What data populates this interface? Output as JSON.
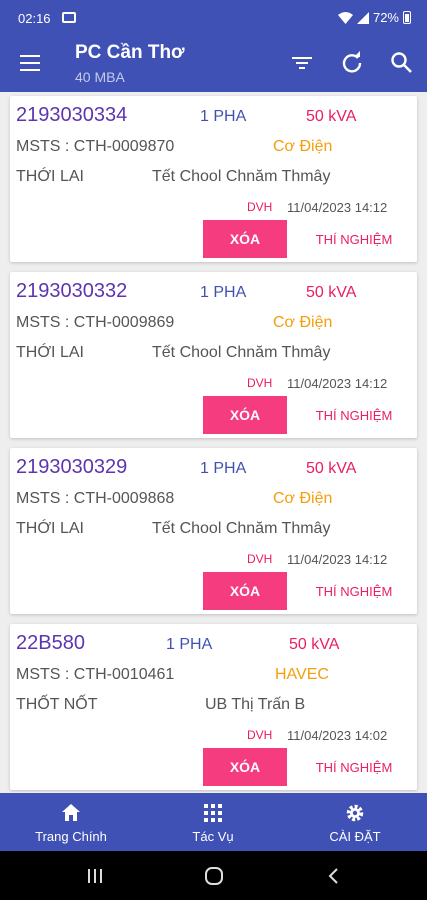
{
  "status": {
    "time": "02:16",
    "battery": "72%"
  },
  "appbar": {
    "title": "PC Cần Thơ",
    "subtitle": "40 MBA"
  },
  "cards": [
    {
      "code": "2193030334",
      "phase": "1 PHA",
      "kva": "50 kVA",
      "msts": "MSTS : CTH-0009870",
      "type": "Cơ Điện",
      "location": "THỚI LAI",
      "area": "Tết Chool Chnăm Thmây",
      "dvh": "DVH",
      "datetime": "11/04/2023 14:12",
      "delete_label": "XÓA",
      "test_label": "THÍ NGHIỆM"
    },
    {
      "code": "2193030332",
      "phase": "1 PHA",
      "kva": "50 kVA",
      "msts": "MSTS : CTH-0009869",
      "type": "Cơ Điện",
      "location": "THỚI LAI",
      "area": "Tết Chool Chnăm Thmây",
      "dvh": "DVH",
      "datetime": "11/04/2023 14:12",
      "delete_label": "XÓA",
      "test_label": "THÍ NGHIỆM"
    },
    {
      "code": "2193030329",
      "phase": "1 PHA",
      "kva": "50 kVA",
      "msts": "MSTS : CTH-0009868",
      "type": "Cơ Điện",
      "location": "THỚI LAI",
      "area": "Tết Chool Chnăm Thmây",
      "dvh": "DVH",
      "datetime": "11/04/2023 14:12",
      "delete_label": "XÓA",
      "test_label": "THÍ NGHIỆM"
    },
    {
      "code": "22B580",
      "phase": "1 PHA",
      "kva": "50 kVA",
      "msts": "MSTS : CTH-0010461",
      "type": "HAVEC",
      "location": "THỐT NỐT",
      "area": "UB Thị Trấn B",
      "dvh": "DVH",
      "datetime": "11/04/2023 14:02",
      "delete_label": "XÓA",
      "test_label": "THÍ NGHIỆM"
    }
  ],
  "bottomnav": {
    "home": "Trang Chính",
    "tasks": "Tác Vụ",
    "settings": "CÀI ĐẶT"
  }
}
